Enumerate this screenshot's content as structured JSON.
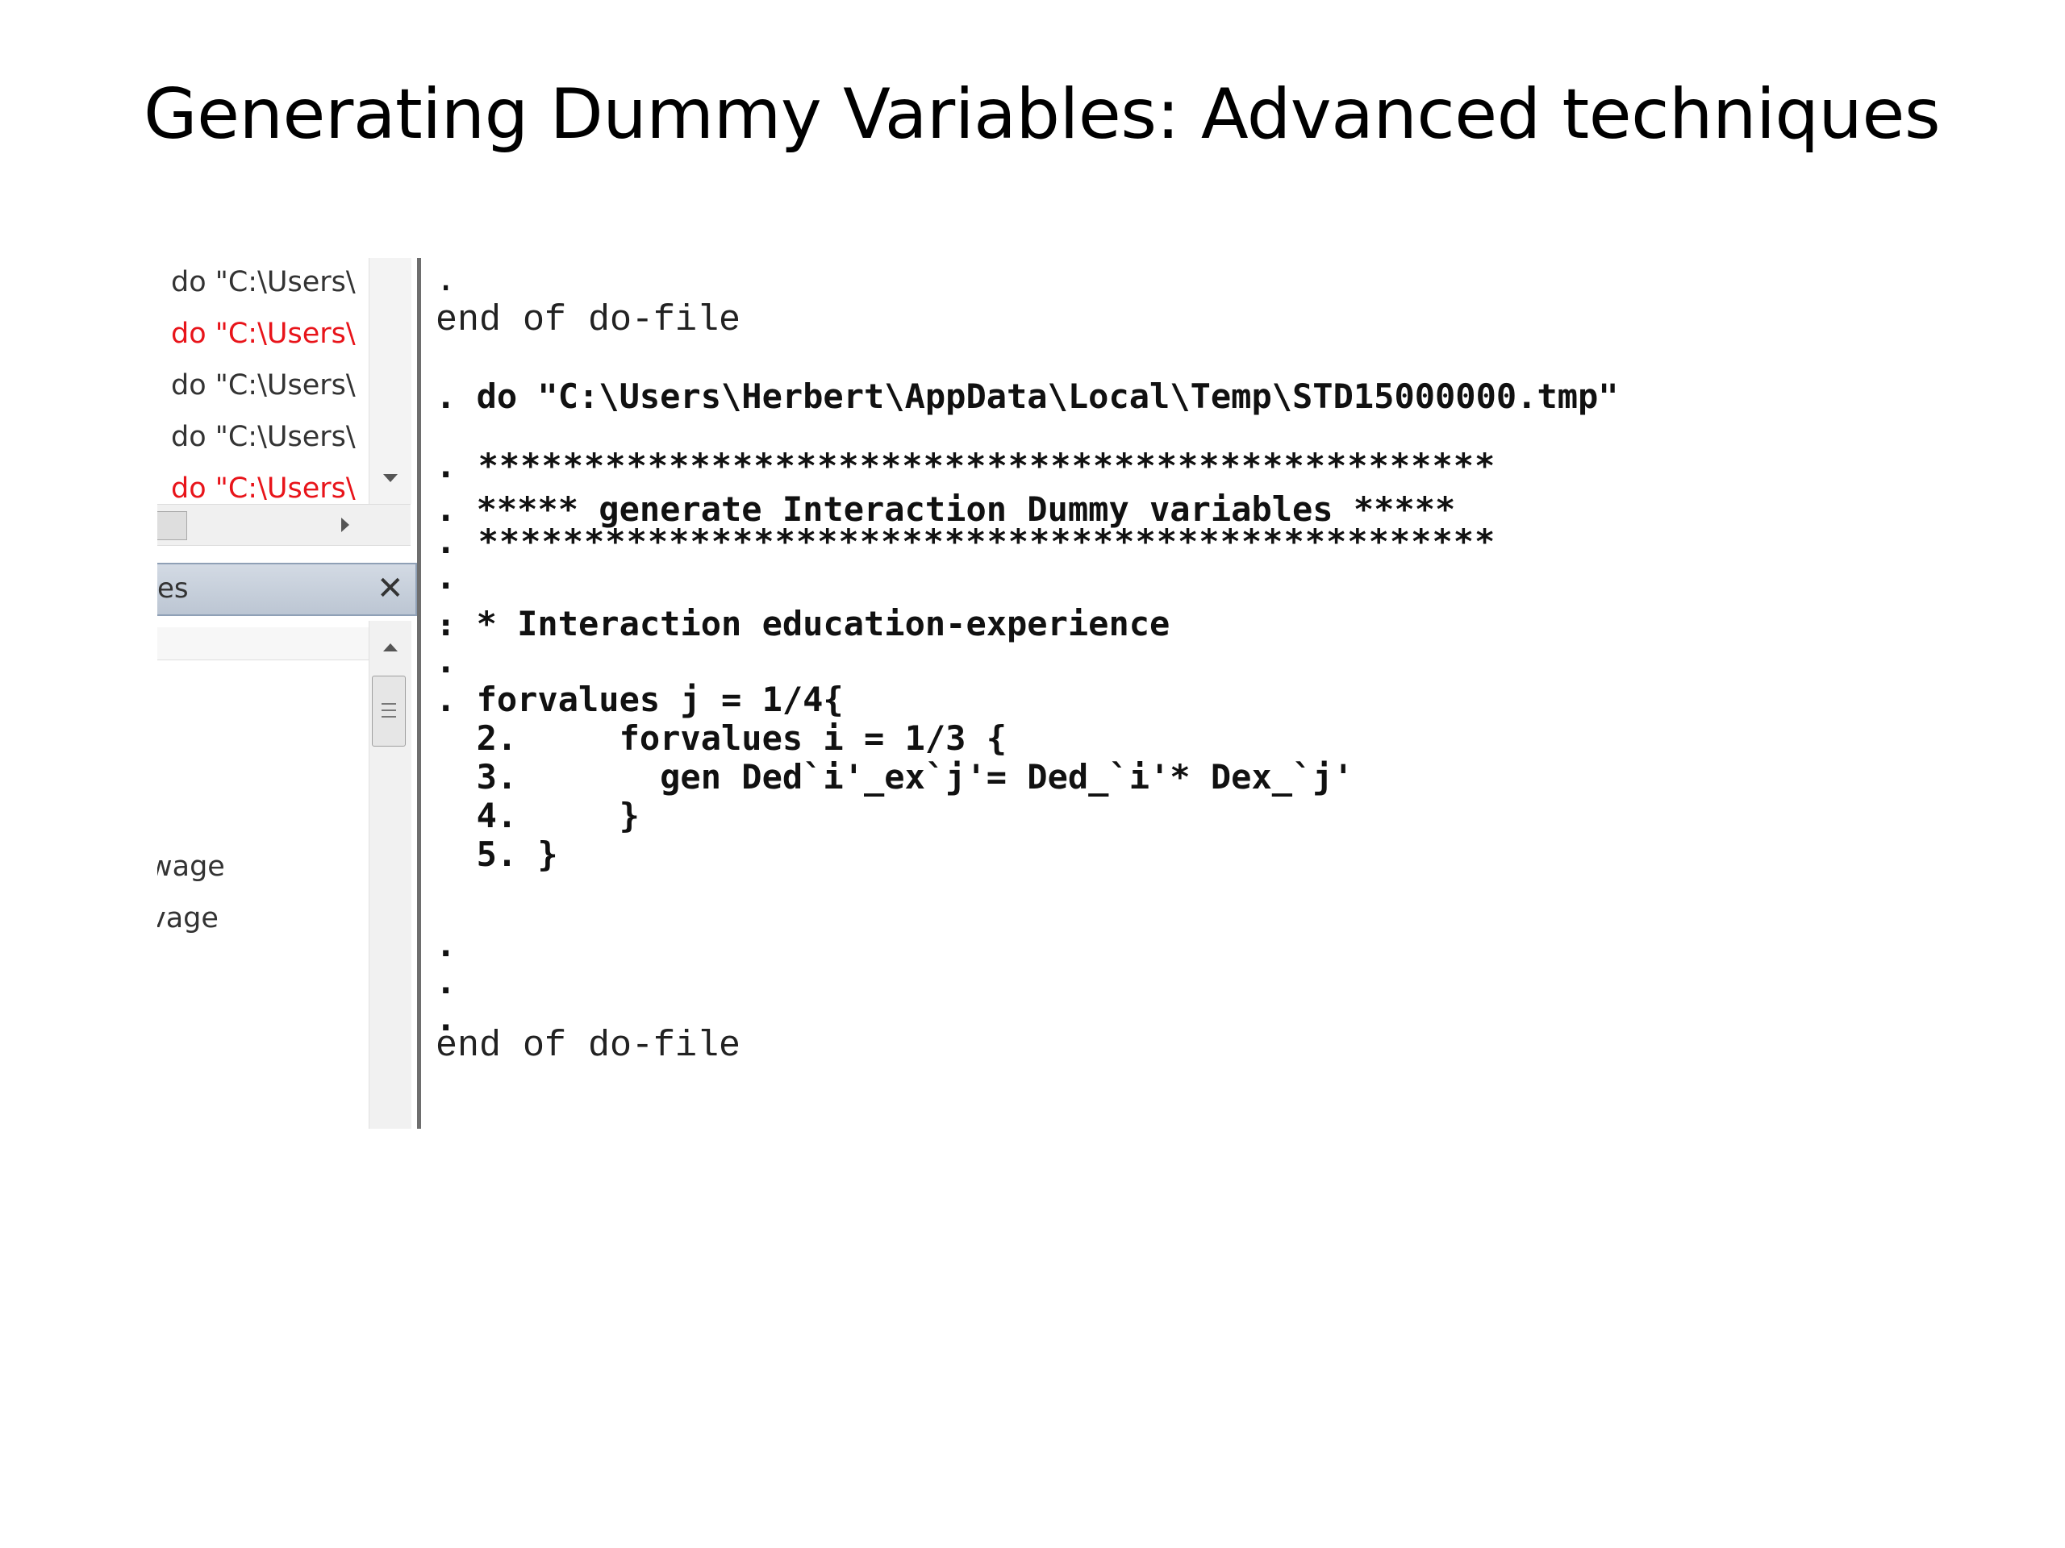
{
  "slide": {
    "title": "Generating Dummy Variables: Advanced techniques"
  },
  "review_panel": {
    "items": [
      {
        "text": "do \"C:\\Users\\",
        "status": "ok"
      },
      {
        "text": "do \"C:\\Users\\",
        "status": "error"
      },
      {
        "text": "do \"C:\\Users\\",
        "status": "ok"
      },
      {
        "text": "do \"C:\\Users\\",
        "status": "ok"
      },
      {
        "text": "do \"C:\\Users\\",
        "status": "error"
      }
    ],
    "error_color": "#e8141a"
  },
  "variables_panel": {
    "header_label": "es",
    "close_icon": "close-icon",
    "items": [
      "wage",
      "vage"
    ]
  },
  "results": {
    "lines": [
      {
        "text": ".",
        "style": "bold"
      },
      {
        "text": "end of do-file",
        "style": "plain"
      },
      {
        "text": ". do \"C:\\Users\\Herbert\\AppData\\Local\\Temp\\STD15000000.tmp\"",
        "style": "bold"
      },
      {
        "text": ". ************************************************",
        "style": "stars"
      },
      {
        "text": ". ***** generate Interaction Dummy variables *****",
        "style": "bold"
      },
      {
        "text": ". ************************************************",
        "style": "stars"
      },
      {
        "text": ".",
        "style": "bold"
      },
      {
        "text": ".",
        "style": "bold"
      },
      {
        "text": ". * Interaction education-experience",
        "style": "bold"
      },
      {
        "text": ".",
        "style": "bold"
      },
      {
        "text": ". forvalues j = 1/4{",
        "style": "bold"
      },
      {
        "text": "  2.     forvalues i = 1/3 {",
        "style": "bold"
      },
      {
        "text": "  3.       gen Ded`i'_ex`j'= Ded_`i'* Dex_`j'",
        "style": "bold"
      },
      {
        "text": "  4.     }",
        "style": "bold"
      },
      {
        "text": "  5. }",
        "style": "bold"
      },
      {
        "text": ".",
        "style": "bold"
      },
      {
        "text": ".",
        "style": "bold"
      },
      {
        "text": ".",
        "style": "bold"
      },
      {
        "text": "end of do-file",
        "style": "plain"
      }
    ]
  }
}
